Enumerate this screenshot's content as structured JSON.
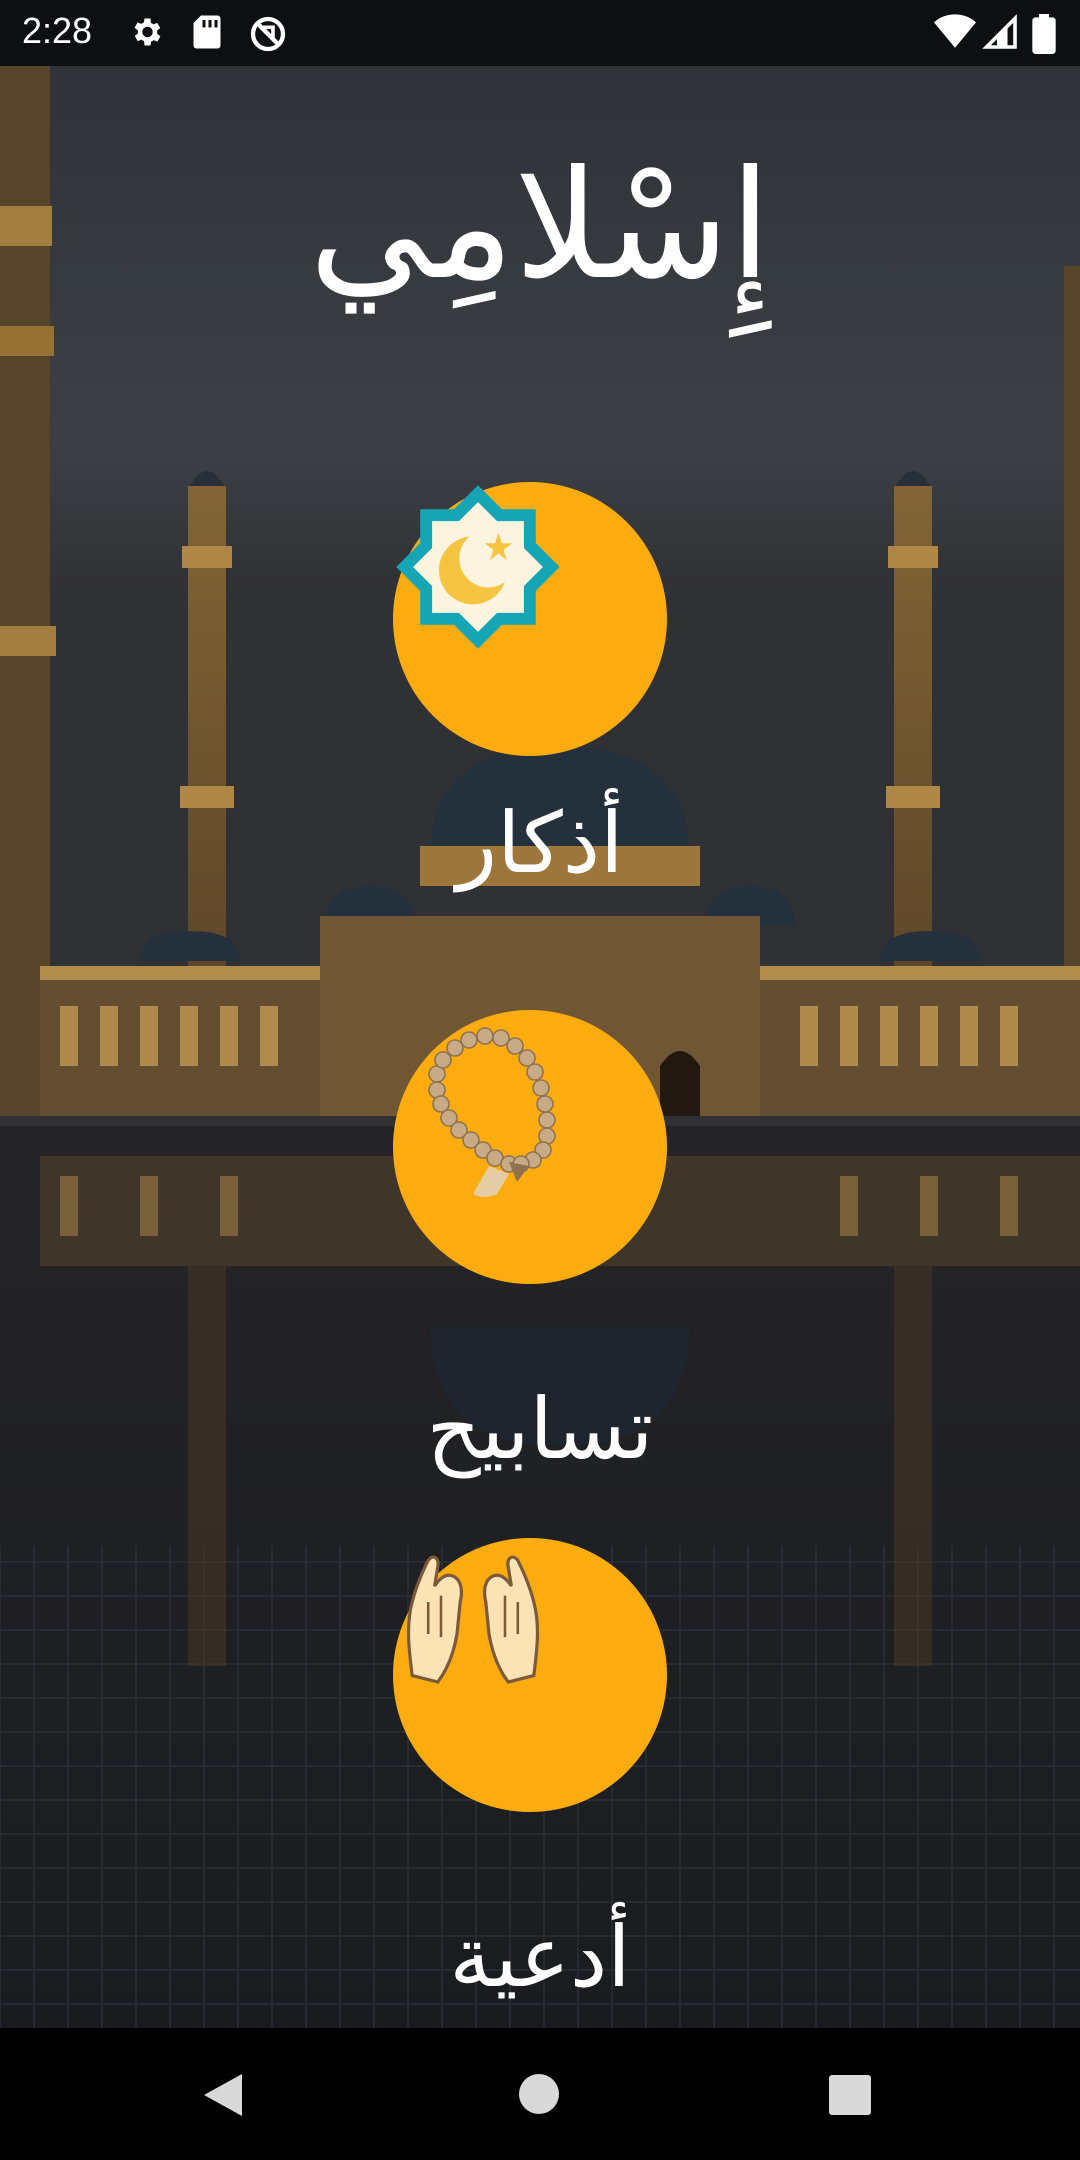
{
  "status_bar": {
    "time": "2:28",
    "icons": [
      "gear-icon",
      "sd-card-icon",
      "sync-off-icon",
      "wifi-icon",
      "signal-icon",
      "battery-icon"
    ]
  },
  "app": {
    "title": "إِسْلامِي"
  },
  "menu": [
    {
      "label": "أذكار",
      "icon": "islamic-star-crescent-icon"
    },
    {
      "label": "تسابيح",
      "icon": "prayer-beads-icon"
    },
    {
      "label": "أدعية",
      "icon": "praying-hands-icon"
    }
  ],
  "colors": {
    "accent": "#fdac10",
    "text": "#ffffff"
  },
  "nav_bar": {
    "icons": [
      "back-icon",
      "home-icon",
      "recents-icon"
    ]
  }
}
